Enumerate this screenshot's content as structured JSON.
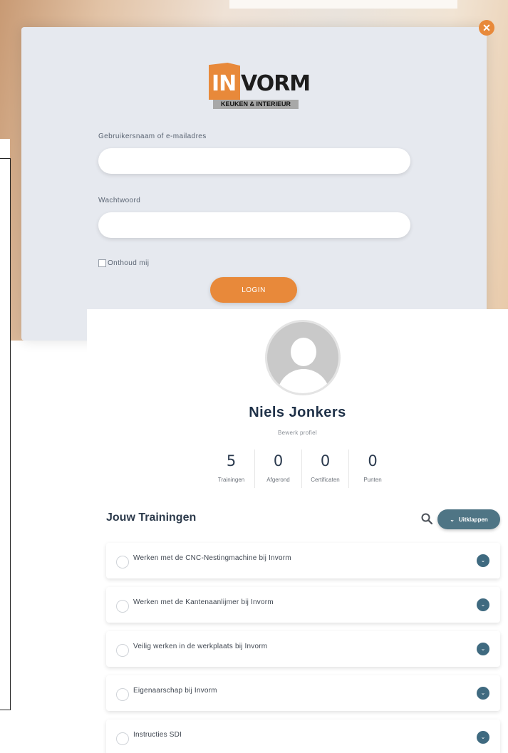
{
  "colors": {
    "accent": "#e8893a",
    "teal": "#4f7585",
    "navy": "#1f3148"
  },
  "login": {
    "close_icon": "close-icon",
    "logo": {
      "in": "IN",
      "vorm": "VORM",
      "tagline": "KEUKEN & INTERIEUR"
    },
    "username_label": "Gebruikersnaam of e-mailadres",
    "username_value": "",
    "password_label": "Wachtwoord",
    "password_value": "",
    "remember_label": "Onthoud mij",
    "login_button": "LOGIN"
  },
  "profile": {
    "name": "Niels Jonkers",
    "edit_link": "Bewerk profiel",
    "stats": [
      {
        "value": "5",
        "label": "Trainingen"
      },
      {
        "value": "0",
        "label": "Afgerond"
      },
      {
        "value": "0",
        "label": "Certificaten"
      },
      {
        "value": "0",
        "label": "Punten"
      }
    ]
  },
  "trainings": {
    "title": "Jouw Trainingen",
    "search_icon": "search-icon",
    "expand_button": "Uitklappen",
    "items": [
      {
        "title": "Werken met de CNC-Nestingmachine bij Invorm"
      },
      {
        "title": "Werken met de Kantenaanlijmer bij Invorm"
      },
      {
        "title": "Veilig werken in de werkplaats bij Invorm"
      },
      {
        "title": "Eigenaarschap bij Invorm"
      },
      {
        "title": "Instructies SDI"
      }
    ]
  }
}
